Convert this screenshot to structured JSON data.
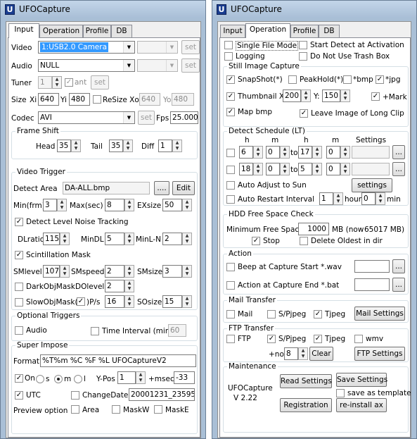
{
  "left": {
    "title": "UFOCapture",
    "tabs": [
      "Input",
      "Operation",
      "Profile",
      "DB"
    ],
    "video_label": "Video",
    "video_value": "1:USB2.0 Camera",
    "audio_label": "Audio",
    "audio_value": "NULL",
    "set": "set",
    "tuner_label": "Tuner",
    "tuner_value": "1",
    "ant_label": "ant",
    "size_label": "Size",
    "xi_label": "Xi",
    "xi": "640",
    "yi_label": "Yi",
    "yi": "480",
    "resize_label": "ReSize Xo",
    "xo": "640",
    "yo_label": "Yo",
    "yo": "480",
    "codec_label": "Codec",
    "codec_value": "AVI",
    "fps_label": "Fps",
    "fps": "25.000",
    "frame_shift": {
      "title": "Frame Shift",
      "head_label": "Head",
      "head": "35",
      "tail_label": "Tail",
      "tail": "35",
      "diff_label": "Diff",
      "diff": "1"
    },
    "trigger": {
      "title": "Video Trigger",
      "detect_area_label": "Detect Area",
      "detect_area": "DA-ALL.bmp",
      "browse": "....",
      "edit": "Edit",
      "min_label": "Min(frm)",
      "min": "3",
      "max_label": "Max(sec)",
      "max": "8",
      "exsize_label": "EXsize",
      "exsize": "50",
      "noise_label": "Detect Level Noise Tracking",
      "dlratio_label": "DLratio",
      "dlratio": "115",
      "mindl_label": "MinDL",
      "mindl": "5",
      "minln_label": "MinL-N",
      "minln": "2",
      "scint_label": "Scintillation Mask",
      "smlevel_label": "SMlevel",
      "smlevel": "107",
      "smspeed_label": "SMspeed",
      "smspeed": "2",
      "smsize_label": "SMsize",
      "smsize": "3",
      "darkobj_label": "DarkObjMask",
      "dolevel_label": "DOlevel",
      "dolevel": "2",
      "slowobj_label": "SlowObjMask(",
      "ps_label": ")P/s",
      "ps": "16",
      "sosize_label": "SOsize",
      "sosize": "15"
    },
    "optional": {
      "title": "Optional Triggers",
      "audio_label": "Audio",
      "interval_label": "Time Interval (min)",
      "interval": "60"
    },
    "superimpose": {
      "title": "Super Impose",
      "format_label": "Format",
      "format": "%T%m %C %F %L UFOCaptureV2",
      "on_label": "On",
      "s_label": "s",
      "m_label": "m",
      "l_label": "l",
      "ypos_label": "Y-Pos",
      "ypos": "1",
      "msec_label": "+msec",
      "msec": "-33",
      "utc_label": "UTC",
      "changedate_label": "ChangeDate",
      "changedate": "20001231_235959",
      "preview_label": "Preview option",
      "area_label": "Area",
      "maskw_label": "MaskW",
      "maske_label": "MaskE"
    }
  },
  "right": {
    "title": "UFOCapture",
    "tabs": [
      "Input",
      "Operation",
      "Profile",
      "DB"
    ],
    "single_file": "Single File Mode",
    "start_detect": "Start Detect at Activation",
    "logging": "Logging",
    "no_trash": "Do Not Use Trash Box",
    "still": {
      "title": "Still Image Capture",
      "snapshot": "SnapShot(*)",
      "peakhold": "PeakHold(*)",
      "bmp": "*bmp",
      "jpg": "*jpg",
      "thumbnail": "Thumbnail X:",
      "thumb_x": "200",
      "y_label": "Y:",
      "thumb_y": "150",
      "mark": "+Mark",
      "mapbmp": "Map bmp",
      "longclip": "Leave Image of Long Clip"
    },
    "schedule": {
      "title": "Detect Schedule (LT)",
      "h": "h",
      "m": "m",
      "settings_hdr": "Settings",
      "to": "to",
      "row1": [
        "6",
        "0",
        "17",
        "0"
      ],
      "row2": [
        "18",
        "0",
        "5",
        "0"
      ],
      "browse": "...",
      "adjust_sun": "Auto Adjust to Sun",
      "settings_btn": "settings",
      "auto_restart": "Auto Restart Interval",
      "restart_h": "1",
      "hour": "hour",
      "restart_m": "0",
      "min": "min"
    },
    "hdd": {
      "title": "HDD Free Space Check",
      "min_free": "Minimum Free Space",
      "min_value": "1000",
      "mb_now": "MB (now",
      "now_value": "65017 MB)",
      "stop": "Stop",
      "delete_oldest": "Delete Oldest in dir"
    },
    "action": {
      "title": "Action",
      "beep": "Beep at Capture Start *.wav",
      "exec": "Action at Capture End *.bat",
      "browse": "..."
    },
    "mail": {
      "title": "Mail Transfer",
      "mail": "Mail",
      "spjpeg": "S/Pjpeg",
      "tjpeg": "Tjpeg",
      "settings": "Mail Settings"
    },
    "ftp": {
      "title": "FTP Transfer",
      "ftp": "FTP",
      "spjpeg": "S/Pjpeg",
      "tjpeg": "Tjpeg",
      "wmv": "wmv",
      "no_label": "+no.",
      "no": "8",
      "clear": "Clear",
      "settings": "FTP Settings"
    },
    "maint": {
      "title": "Maintenance",
      "app": "UFOCapture",
      "version": "V 2.22",
      "read": "Read Settings",
      "save": "Save Settings",
      "template": "save as template",
      "registration": "Registration",
      "reinstall": "re-install ax"
    }
  }
}
